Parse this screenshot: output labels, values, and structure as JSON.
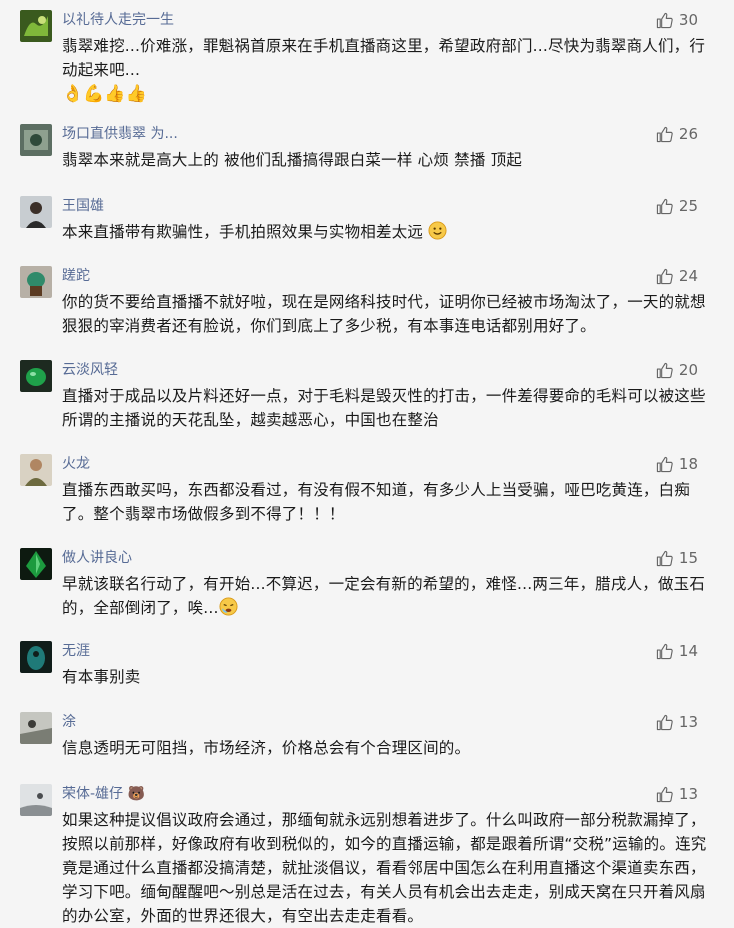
{
  "comments": [
    {
      "name": "以礼待人走完一生",
      "likes": "30",
      "text": "翡翠难挖...价难涨，罪魁祸首原来在手机直播商这里，希望政府部门...尽快为翡翠商人们，行动起来吧...",
      "emoji": "👌💪👍👍"
    },
    {
      "name": "场口直供翡翠 为...",
      "likes": "26",
      "text": "翡翠本来就是高大上的 被他们乱播搞得跟白菜一样 心烦 禁播 顶起"
    },
    {
      "name": "王国雄",
      "likes": "25",
      "text": "本来直播带有欺骗性，手机拍照效果与实物相差太远"
    },
    {
      "name": "蹉跎",
      "likes": "24",
      "text": "你的货不要给直播播不就好啦，现在是网络科技时代，证明你已经被市场淘汰了，一天的就想狠狠的宰消费者还有脸说，你们到底上了多少税，有本事连电话都别用好了。"
    },
    {
      "name": "云淡风轻",
      "likes": "20",
      "text": "直播对于成品以及片料还好一点，对于毛料是毁灭性的打击，一件差得要命的毛料可以被这些所谓的主播说的天花乱坠，越卖越恶心，中国也在整治"
    },
    {
      "name": "火龙",
      "likes": "18",
      "text": "直播东西敢买吗，东西都没看过，有没有假不知道，有多少人上当受骗，哑巴吃黄连，白痴了。整个翡翠市场做假多到不得了！！！"
    },
    {
      "name": "做人讲良心",
      "likes": "15",
      "text": "早就该联名行动了，有开始...不算迟，一定会有新的希望的，难怪...两三年，腊戌人，做玉石的，全部倒闭了，唉..."
    },
    {
      "name": "无涯",
      "likes": "14",
      "text": "有本事别卖"
    },
    {
      "name": "涂",
      "likes": "13",
      "text": "信息透明无可阻挡，市场经济，价格总会有个合理区间的。"
    },
    {
      "name": "荣体-雄仔 🐻",
      "likes": "13",
      "text": "如果这种提议倡议政府会通过，那缅甸就永远别想着进步了。什么叫政府一部分税款漏掉了，按照以前那样，好像政府有收到税似的，如今的直播运输，都是跟着所谓“交税”运输的。连究竟是通过什么直播都没搞清楚，就扯淡倡议，看看邻居中国怎么在利用直播这个渠道卖东西，学习下吧。缅甸醒醒吧～别总是活在过去，有关人员有机会出去走走，别成天窝在只开着风扇的办公室，外面的世界还很大，有空出去走走看看。"
    }
  ],
  "colors": {
    "name": "#576b95",
    "text": "#1a1a1a",
    "background": "#f5f5f5",
    "like": "#666666"
  }
}
